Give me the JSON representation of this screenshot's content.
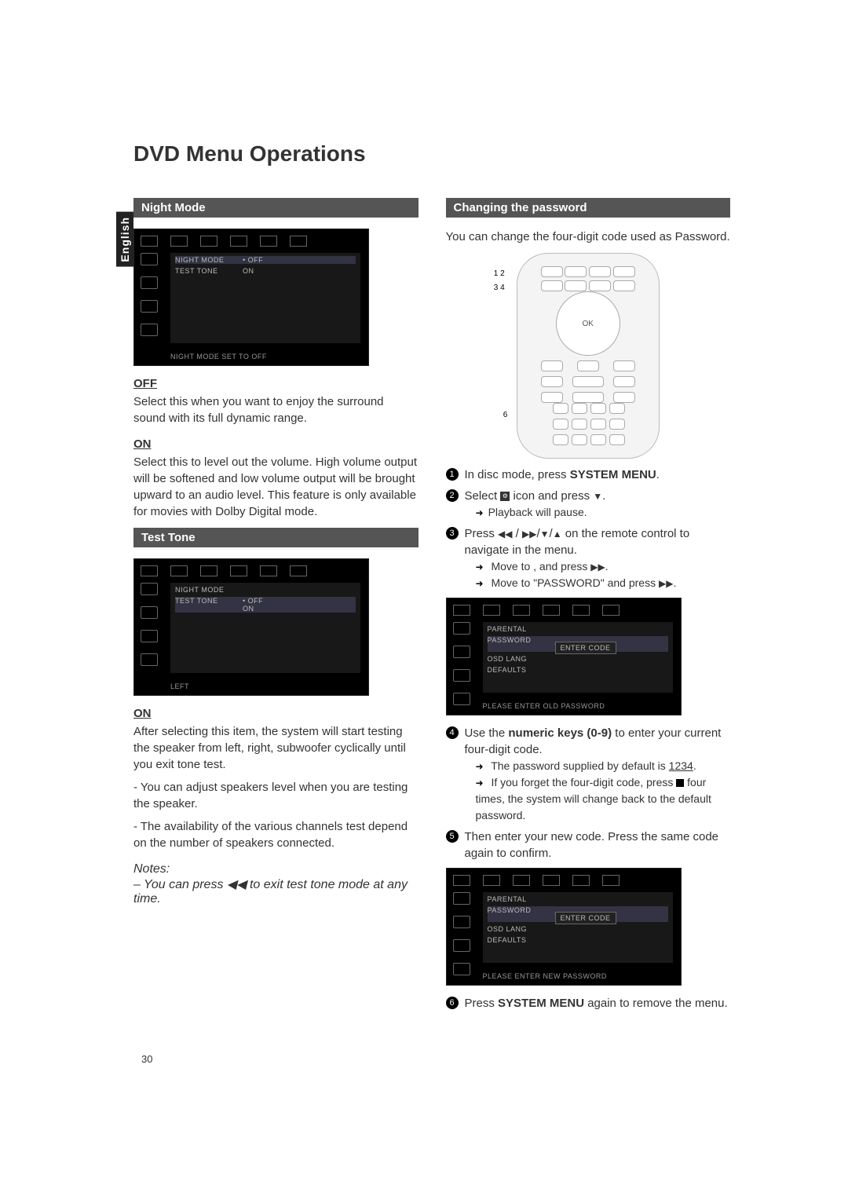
{
  "language_tab": "English",
  "title": "DVD Menu Operations",
  "left": {
    "night_mode": {
      "bar": "Night Mode",
      "osd": {
        "items": [
          "NIGHT MODE",
          "TEST TONE"
        ],
        "values": [
          "OFF",
          "ON"
        ],
        "footer": "NIGHT MODE SET TO OFF"
      },
      "off_h": "OFF",
      "off_p": "Select this when you want to enjoy the surround sound with its full dynamic range.",
      "on_h": "ON",
      "on_p": "Select this to level out the volume. High volume output will be softened and low volume output will be brought upward to an audio level. This feature is only available for movies with Dolby Digital mode."
    },
    "test_tone": {
      "bar": "Test Tone",
      "osd": {
        "items": [
          "NIGHT MODE",
          "TEST TONE"
        ],
        "values": [
          "OFF",
          "ON"
        ],
        "footer": "LEFT"
      },
      "on_h": "ON",
      "on_p1": "After selecting this item, the system will start testing the speaker from left, right, subwoofer cyclically until you exit tone test.",
      "on_p2": " - You can adjust speakers level when you are testing the speaker.",
      "on_p3": " - The availability of the various channels test depend on the number of speakers connected.",
      "notes_h": "Notes:",
      "notes_p": "– You can press ◀◀ to exit test tone mode at any time."
    }
  },
  "right": {
    "bar": "Changing the password",
    "intro": "You can change the four-digit code used as Password.",
    "remote_callouts": [
      "1 2",
      "3 4",
      "6",
      "OK"
    ],
    "steps": {
      "s1": "In disc mode, press ",
      "s1b": "SYSTEM MENU",
      "s1c": ".",
      "s2a": "Select ",
      "s2b": " icon and press ",
      "s2sub": "Playback will pause.",
      "s3a": "Press ",
      "s3b": " on the remote control to navigate in the menu.",
      "s3sub1": "Move to    , and press ",
      "s3sub2": "Move to \"PASSWORD\" and press ",
      "osd1": {
        "menu": [
          "PARENTAL",
          "PASSWORD",
          "OSD LANG",
          "DEFAULTS"
        ],
        "prompt": "ENTER CODE",
        "footer": "PLEASE ENTER OLD PASSWORD"
      },
      "s4a": "Use the ",
      "s4b": "numeric keys (0-9)",
      "s4c": " to enter your current four-digit code.",
      "s4sub1a": "The password supplied by default is ",
      "s4sub1b": "1234",
      "s4sub1c": ".",
      "s4sub2a": "If you forget the four-digit code, press ",
      "s4sub2b": " four times, the system will change back to the default password.",
      "s5": "Then enter your new code. Press the same code again to confirm.",
      "osd2": {
        "menu": [
          "PARENTAL",
          "PASSWORD",
          "OSD LANG",
          "DEFAULTS"
        ],
        "prompt": "ENTER CODE",
        "footer": "PLEASE ENTER NEW PASSWORD"
      },
      "s6a": "Press ",
      "s6b": "SYSTEM MENU",
      "s6c": " again to remove the menu."
    }
  },
  "page_number": "30"
}
